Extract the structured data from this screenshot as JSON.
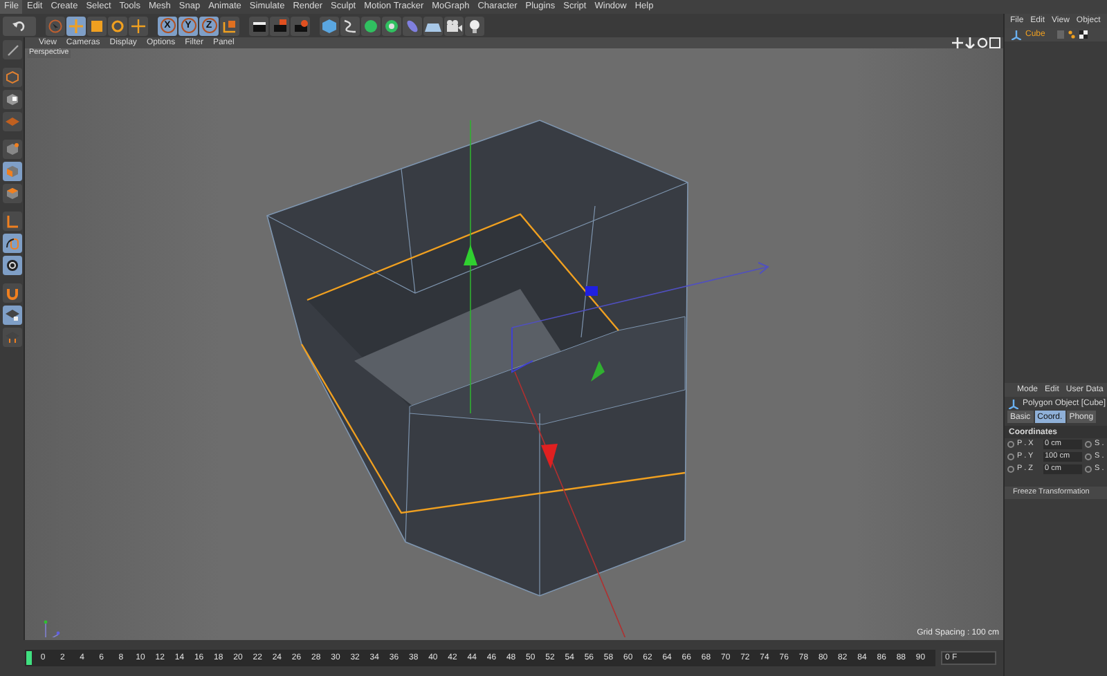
{
  "menu_bar": [
    {
      "label": "File",
      "selected": true
    },
    {
      "label": "Edit",
      "selected": false
    },
    {
      "label": "Create",
      "selected": false
    },
    {
      "label": "Select",
      "selected": false
    },
    {
      "label": "Tools",
      "selected": false
    },
    {
      "label": "Mesh",
      "selected": false
    },
    {
      "label": "Snap",
      "selected": false
    },
    {
      "label": "Animate",
      "selected": false
    },
    {
      "label": "Simulate",
      "selected": false
    },
    {
      "label": "Render",
      "selected": false
    },
    {
      "label": "Sculpt",
      "selected": false
    },
    {
      "label": "Motion Tracker",
      "selected": false
    },
    {
      "label": "MoGraph",
      "selected": false
    },
    {
      "label": "Character",
      "selected": false
    },
    {
      "label": "Plugins",
      "selected": false
    },
    {
      "label": "Script",
      "selected": false
    },
    {
      "label": "Window",
      "selected": false
    },
    {
      "label": "Help",
      "selected": false
    }
  ],
  "toolbar": {
    "axis_buttons": [
      {
        "label": "X",
        "selected": true
      },
      {
        "label": "Y",
        "selected": true
      },
      {
        "label": "Z",
        "selected": true
      }
    ]
  },
  "left_tools": [
    {
      "selected": false
    },
    {
      "selected": false
    },
    {
      "selected": false
    },
    {
      "selected": false
    },
    {
      "selected": false
    },
    {
      "selected": true
    },
    {
      "selected": false
    },
    {
      "selected": false
    },
    {
      "selected": true
    },
    {
      "selected": true
    },
    {
      "selected": false
    },
    {
      "selected": true
    },
    {
      "selected": false
    }
  ],
  "viewport": {
    "menu": [
      "View",
      "Cameras",
      "Display",
      "Options",
      "Filter",
      "Panel"
    ],
    "camera_label": "Perspective",
    "grid_spacing": "Grid Spacing : 100 cm"
  },
  "timeline": {
    "ticks": [
      "0",
      "2",
      "4",
      "6",
      "8",
      "10",
      "12",
      "14",
      "16",
      "18",
      "20",
      "22",
      "24",
      "26",
      "28",
      "30",
      "32",
      "34",
      "36",
      "38",
      "40",
      "42",
      "44",
      "46",
      "48",
      "50",
      "52",
      "54",
      "56",
      "58",
      "60",
      "62",
      "64",
      "66",
      "68",
      "70",
      "72",
      "74",
      "76",
      "78",
      "80",
      "82",
      "84",
      "86",
      "88",
      "90"
    ],
    "frame_field": "0 F"
  },
  "object_manager": {
    "menu": [
      "File",
      "Edit",
      "View",
      "Object"
    ],
    "objects": [
      {
        "name": "Cube",
        "selected": true
      }
    ]
  },
  "attribute_manager": {
    "menu": [
      "Mode",
      "Edit",
      "User Data"
    ],
    "title": "Polygon Object [Cube]",
    "tabs": [
      {
        "label": "Basic",
        "selected": false
      },
      {
        "label": "Coord.",
        "selected": true
      },
      {
        "label": "Phong",
        "selected": false
      }
    ],
    "section": "Coordinates",
    "rows": [
      {
        "label": "P . X",
        "value": "0 cm",
        "right_label": "S ."
      },
      {
        "label": "P . Y",
        "value": "100 cm",
        "right_label": "S ."
      },
      {
        "label": "P . Z",
        "value": "0 cm",
        "right_label": "S ."
      }
    ],
    "freeze_button": "Freeze Transformation"
  }
}
